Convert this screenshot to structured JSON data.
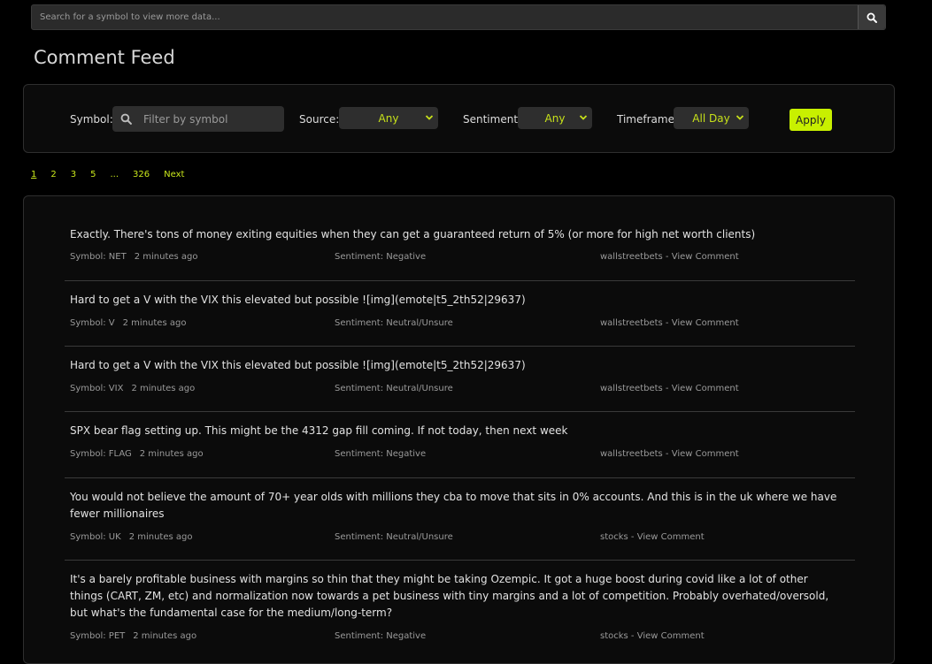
{
  "search": {
    "placeholder": "Search for a symbol to view more data..."
  },
  "page_title": "Comment Feed",
  "filters": {
    "symbol_label": "Symbol:",
    "symbol_placeholder": "Filter by symbol",
    "source_label": "Source:",
    "source_value": "Any",
    "sentiment_label": "Sentiment:",
    "sentiment_value": "Any",
    "timeframe_label": "Timeframe:",
    "timeframe_value": "All Day",
    "apply_label": "Apply"
  },
  "pagination": [
    "1",
    "2",
    "3",
    "5",
    "...",
    "326",
    "Next"
  ],
  "comments": [
    {
      "text": "Exactly. There's tons of money exiting equities when they can get a guaranteed return of 5% (or more for high net worth clients)",
      "symbol": "Symbol: NET",
      "time": "2 minutes ago",
      "sentiment": "Sentiment: Negative",
      "source": "wallstreetbets - View Comment"
    },
    {
      "text": "Hard to get a V with the VIX this elevated but possible ![img](emote|t5_2th52|29637)",
      "symbol": "Symbol: V",
      "time": "2 minutes ago",
      "sentiment": "Sentiment: Neutral/Unsure",
      "source": "wallstreetbets - View Comment"
    },
    {
      "text": "Hard to get a V with the VIX this elevated but possible ![img](emote|t5_2th52|29637)",
      "symbol": "Symbol: VIX",
      "time": "2 minutes ago",
      "sentiment": "Sentiment: Neutral/Unsure",
      "source": "wallstreetbets - View Comment"
    },
    {
      "text": "SPX bear flag setting up. This might be the 4312 gap fill coming. If not today, then next week",
      "symbol": "Symbol: FLAG",
      "time": "2 minutes ago",
      "sentiment": "Sentiment: Negative",
      "source": "wallstreetbets - View Comment"
    },
    {
      "text": "You would not believe the amount of 70+ year olds with millions they cba to move that sits in 0% accounts. And this is in the uk where we have fewer millionaires",
      "symbol": "Symbol: UK",
      "time": "2 minutes ago",
      "sentiment": "Sentiment: Neutral/Unsure",
      "source": "stocks - View Comment"
    },
    {
      "text": "It's a barely profitable business with margins so thin that they might be taking Ozempic. It got a huge boost during covid like a lot of other things (CART, ZM, etc) and normalization now towards a pet business with tiny margins and a lot of competition. Probably overhated/oversold, but what's the fundamental case for the medium/long-term?",
      "symbol": "Symbol: PET",
      "time": "2 minutes ago",
      "sentiment": "Sentiment: Negative",
      "source": "stocks - View Comment"
    }
  ],
  "colors": {
    "accent": "#c8f000",
    "link": "#c8e61b",
    "background": "#000000",
    "panel": "#0b0b0b"
  }
}
